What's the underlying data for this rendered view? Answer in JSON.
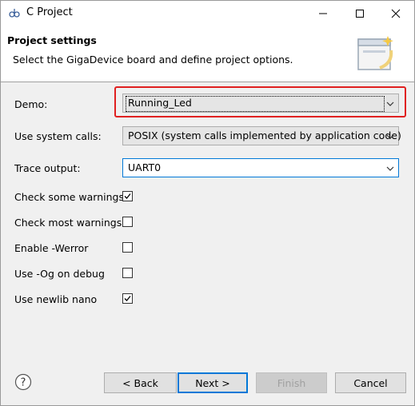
{
  "window": {
    "title": "C Project"
  },
  "header": {
    "title": "Project settings",
    "subtitle": "Select the GigaDevice board and define project options."
  },
  "form": {
    "demo": {
      "label": "Demo:",
      "value": "Running_Led"
    },
    "syscalls": {
      "label": "Use system calls:",
      "value": "POSIX (system calls implemented by application code)"
    },
    "trace": {
      "label": "Trace output:",
      "value": "UART0"
    },
    "checkboxes": [
      {
        "label": "Check some warnings",
        "checked": true
      },
      {
        "label": "Check most warnings",
        "checked": false
      },
      {
        "label": "Enable -Werror",
        "checked": false
      },
      {
        "label": "Use -Og on debug",
        "checked": false
      },
      {
        "label": "Use newlib nano",
        "checked": true
      }
    ]
  },
  "buttons": {
    "back": "< Back",
    "next": "Next >",
    "finish": "Finish",
    "cancel": "Cancel"
  },
  "colors": {
    "highlight": "#e02020",
    "focus": "#0078d7"
  }
}
